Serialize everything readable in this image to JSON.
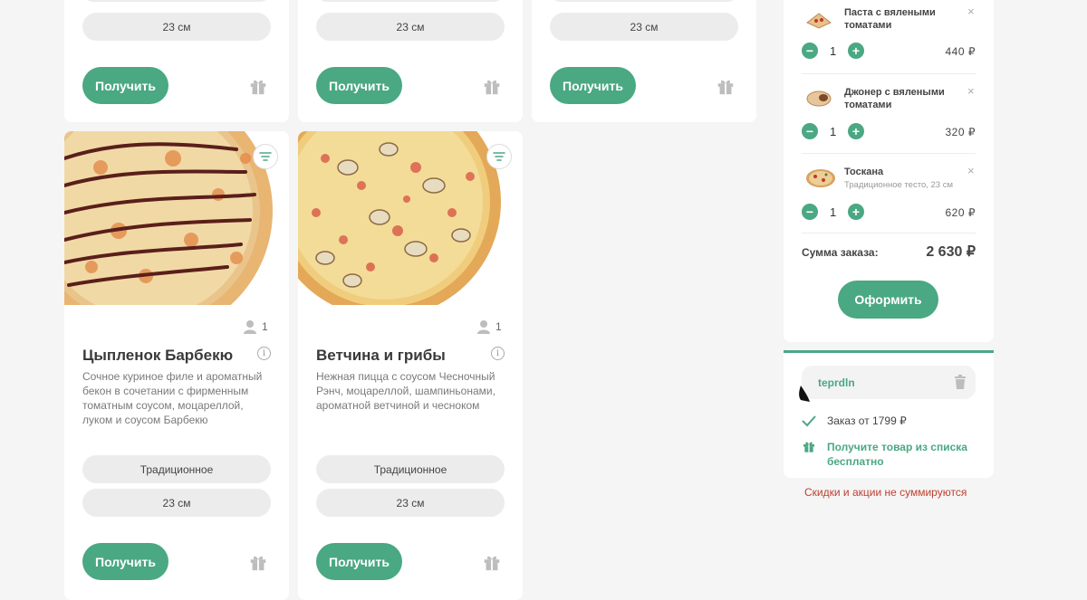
{
  "colors": {
    "accent": "#4aa883",
    "note": "#c04030"
  },
  "top_cards": [
    {
      "size": "23 см",
      "button": "Получить"
    },
    {
      "size": "23 см",
      "button": "Получить"
    },
    {
      "size": "23 см",
      "button": "Получить"
    }
  ],
  "pizzas": [
    {
      "title": "Цыпленок Барбекю",
      "description": "Сочное куриное филе и ароматный бекон в сочетании с фирменным томатным соусом, моцареллой, луком и соусом Барбекю",
      "persons": "1",
      "dough": "Традиционное",
      "size": "23 см",
      "button": "Получить",
      "image": "bbq-chicken-pizza"
    },
    {
      "title": "Ветчина и грибы",
      "description": "Нежная пицца с соусом Чесночный Рэнч, моцареллой, шампиньонами, ароматной ветчиной и чесноком",
      "persons": "1",
      "dough": "Традиционное",
      "size": "23 см",
      "button": "Получить",
      "image": "ham-mushroom-pizza"
    }
  ],
  "cart": {
    "items": [
      {
        "name": "Паста с вялеными томатами",
        "subtitle": "",
        "qty": "1",
        "price": "440 ₽"
      },
      {
        "name": "Джонер с вялеными томатами",
        "subtitle": "",
        "qty": "1",
        "price": "320 ₽"
      },
      {
        "name": "Тоскана",
        "subtitle": "Традиционное тесто, 23 см",
        "qty": "1",
        "price": "620 ₽"
      }
    ],
    "total_label": "Сумма заказа:",
    "total_value": "2 630 ₽",
    "order_button": "Оформить"
  },
  "promo": {
    "code": "teprdln",
    "condition": "Заказ от 1799 ₽",
    "reward": "Получите товар из списка бесплатно"
  },
  "note": "Скидки и акции не суммируются"
}
